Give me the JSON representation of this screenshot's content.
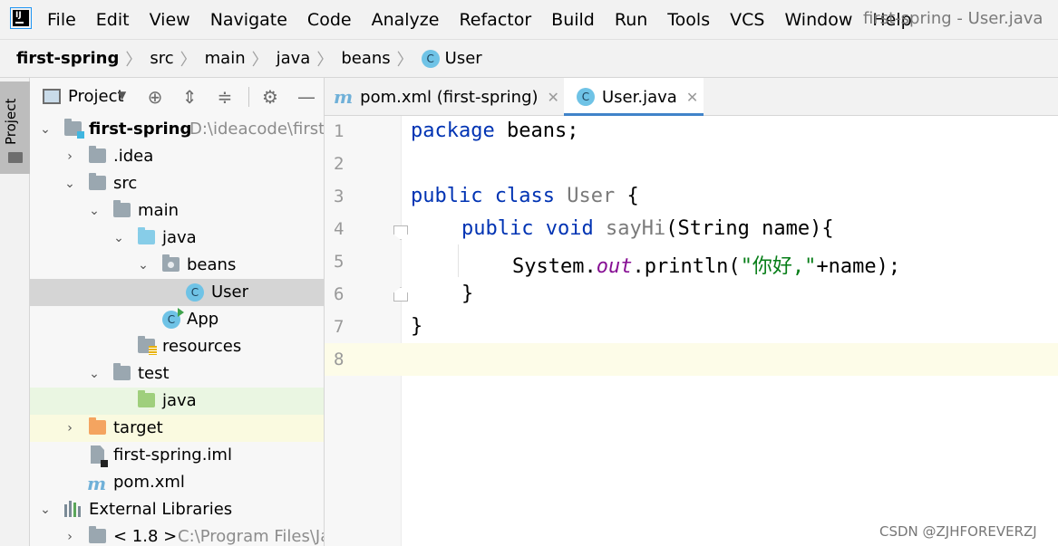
{
  "menubar": {
    "items": [
      "File",
      "Edit",
      "View",
      "Navigate",
      "Code",
      "Analyze",
      "Refactor",
      "Build",
      "Run",
      "Tools",
      "VCS",
      "Window",
      "Help"
    ],
    "window_title": "first-spring - User.java"
  },
  "breadcrumb": {
    "items": [
      "first-spring",
      "src",
      "main",
      "java",
      "beans",
      "User"
    ]
  },
  "toolstrip": {
    "project_label": "Project"
  },
  "project_panel": {
    "view_label": "Project",
    "tree": [
      {
        "label": "first-spring",
        "hint": "D:\\ideacode\\first-",
        "icon": "module-folder-icon",
        "arrow": "expanded"
      },
      {
        "label": ".idea",
        "icon": "folder-icon",
        "arrow": "collapsed"
      },
      {
        "label": "src",
        "icon": "folder-icon",
        "arrow": "expanded"
      },
      {
        "label": "main",
        "icon": "folder-icon",
        "arrow": "expanded"
      },
      {
        "label": "java",
        "icon": "source-folder-icon",
        "arrow": "expanded"
      },
      {
        "label": "beans",
        "icon": "package-icon",
        "arrow": "expanded"
      },
      {
        "label": "User",
        "icon": "class-icon",
        "arrow": "none",
        "selected": true
      },
      {
        "label": "App",
        "icon": "runnable-class-icon",
        "arrow": "none"
      },
      {
        "label": "resources",
        "icon": "resources-folder-icon",
        "arrow": "none"
      },
      {
        "label": "test",
        "icon": "folder-icon",
        "arrow": "expanded"
      },
      {
        "label": "java",
        "icon": "test-folder-icon",
        "arrow": "none"
      },
      {
        "label": "target",
        "icon": "excluded-folder-icon",
        "arrow": "collapsed"
      },
      {
        "label": "first-spring.iml",
        "icon": "iml-file-icon",
        "arrow": "none"
      },
      {
        "label": "pom.xml",
        "icon": "maven-icon",
        "arrow": "none"
      },
      {
        "label": "External Libraries",
        "icon": "library-icon",
        "arrow": "expanded"
      },
      {
        "label": "< 1.8 >",
        "hint": "C:\\Program Files\\Ja",
        "icon": "folder-icon",
        "arrow": "collapsed"
      }
    ]
  },
  "tabs": [
    {
      "label": "pom.xml (first-spring)",
      "icon": "maven-icon",
      "active": false
    },
    {
      "label": "User.java",
      "icon": "class-icon",
      "active": true
    }
  ],
  "editor": {
    "line_numbers": [
      "1",
      "2",
      "3",
      "4",
      "5",
      "6",
      "7",
      "8"
    ],
    "code": {
      "l1_kw": "package",
      "l1_rest": " beans;",
      "l3_kw1": "public",
      "l3_kw2": "class",
      "l3_cls": "User",
      "l3_rest": " {",
      "l4_kw1": "public",
      "l4_kw2": "void",
      "l4_method": "sayHi",
      "l4_rest": "(String name){",
      "l5_a": "System.",
      "l5_field": "out",
      "l5_b": ".println(",
      "l5_str": "\"你好,\"",
      "l5_c": "+name);",
      "l6": "}",
      "l7": "}"
    }
  },
  "watermark": "CSDN @ZJHFOREVERZJ",
  "colors": {
    "keyword": "#0033b3",
    "string": "#067d17",
    "field": "#871094",
    "selection": "#d5d5d5",
    "tab_underline": "#4083c9"
  }
}
